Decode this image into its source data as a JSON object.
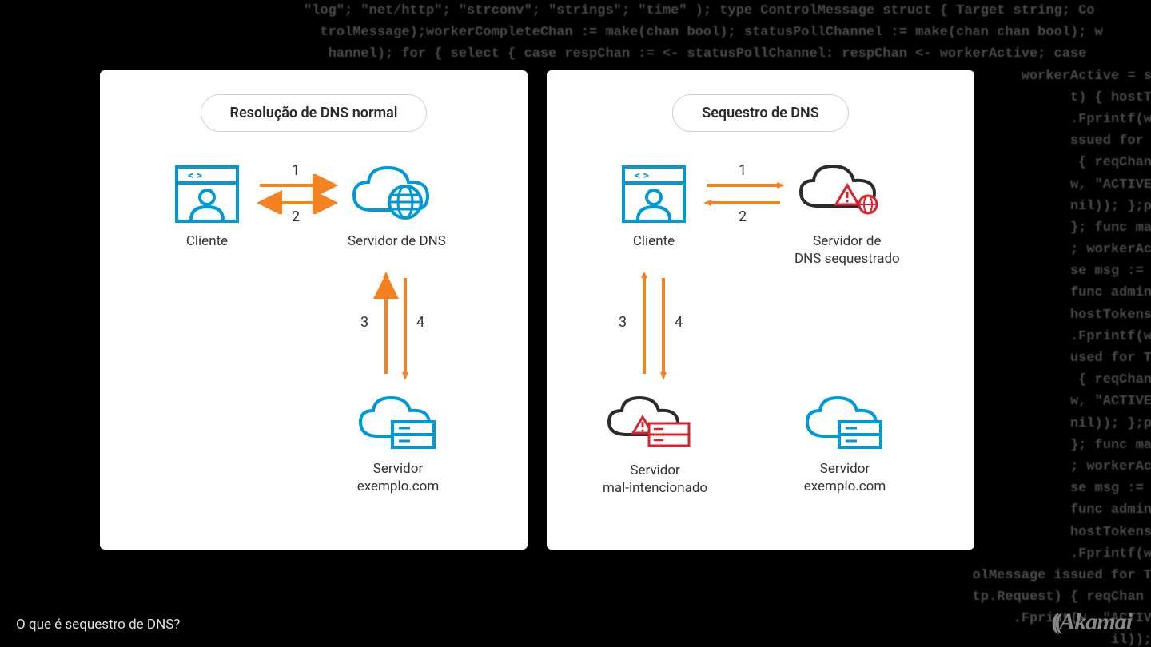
{
  "caption": "O que é sequestro de DNS?",
  "logo": "Akamai",
  "code_bg": "\"log\"; \"net/http\"; \"strconv\"; \"strings\"; \"time\" ); type ControlMessage struct { Target string; Co\n  trolMessage);workerCompleteChan := make(chan bool); statusPollChannel := make(chan chan bool); w\n   hannel); for { select { case respChan := <- statusPollChannel: respChan <- workerActive; case\n                                                                                        workerActive = status; }\n                                                                                              t) { hostTok\n                                                                                              .Fprintf(w,\n                                                                                              ssued for Ta\n                                                                                               { reqChan\n                                                                                              w, \"ACTIVE\")\n                                                                                              nil)); };pa\n                                                                                              }; func ma\n                                                                                              ; workerAct\n                                                                                              se msg := <\n                                                                                              func admin(\n                                                                                              hostTokens\n                                                                                              .Fprintf(w,\n                                                                                              used for Ta\n                                                                                               { reqChan\n                                                                                              w, \"ACTIVE\")\n                                                                                              nil)); };pa\n                                                                                              }; func ma\n                                                                                              ; workerAct\n                                                                                              se msg := <\n                                                                                              func admin(\n                                                                                              hostTokens\n                                                                                              .Fprintf(w,\n                                                                                  olMessage issued for Ta\n                                                                                  tp.Request) { reqChan\n                                                                                       .Fprint(w, \"ACTIVE\")\n                                                                                                   il)); };p\n                                                                                                   workerAct",
  "panels": {
    "left": {
      "title": "Resolução de DNS normal",
      "client_label": "Cliente",
      "dns_label": "Servidor de DNS",
      "server_label_1": "Servidor",
      "server_label_2": "exemplo.com",
      "step1": "1",
      "step2": "2",
      "step3": "3",
      "step4": "4"
    },
    "right": {
      "title": "Sequestro de DNS",
      "client_label": "Cliente",
      "dns_label_1": "Servidor de",
      "dns_label_2": "DNS sequestrado",
      "mal_label_1": "Servidor",
      "mal_label_2": "mal-intencionado",
      "server_label_1": "Servidor",
      "server_label_2": "exemplo.com",
      "step1": "1",
      "step2": "2",
      "step3": "3",
      "step4": "4"
    }
  }
}
